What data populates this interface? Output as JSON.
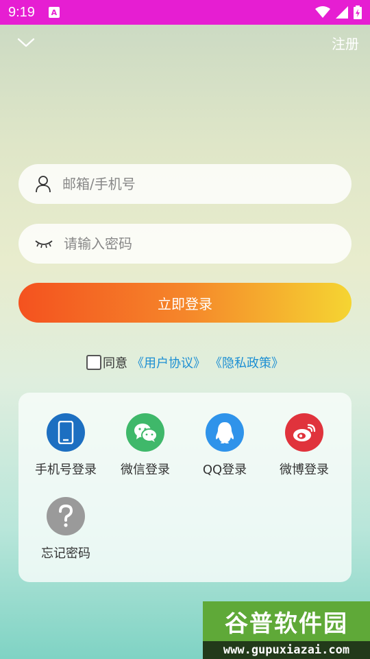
{
  "status_bar": {
    "time": "9:19",
    "notification_icon": "A"
  },
  "topbar": {
    "back_icon": "chevron-down-icon",
    "register_label": "注册"
  },
  "form": {
    "account_placeholder": "邮箱/手机号",
    "password_placeholder": "请输入密码",
    "login_button_label": "立即登录"
  },
  "agreement": {
    "checked": false,
    "agree_text": "同意",
    "user_agreement_link": "《用户协议》",
    "privacy_policy_link": "《隐私政策》"
  },
  "login_options": [
    {
      "label": "手机号登录",
      "icon": "phone-icon",
      "color": "#1d6fc1"
    },
    {
      "label": "微信登录",
      "icon": "wechat-icon",
      "color": "#3fb86a"
    },
    {
      "label": "QQ登录",
      "icon": "qq-icon",
      "color": "#2f93ea"
    },
    {
      "label": "微博登录",
      "icon": "weibo-icon",
      "color": "#e0333c"
    },
    {
      "label": "忘记密码",
      "icon": "question-icon",
      "color": "#9a9a9a"
    }
  ],
  "watermark": {
    "title": "谷普软件园",
    "url": "www.gupuxiazai.com"
  }
}
